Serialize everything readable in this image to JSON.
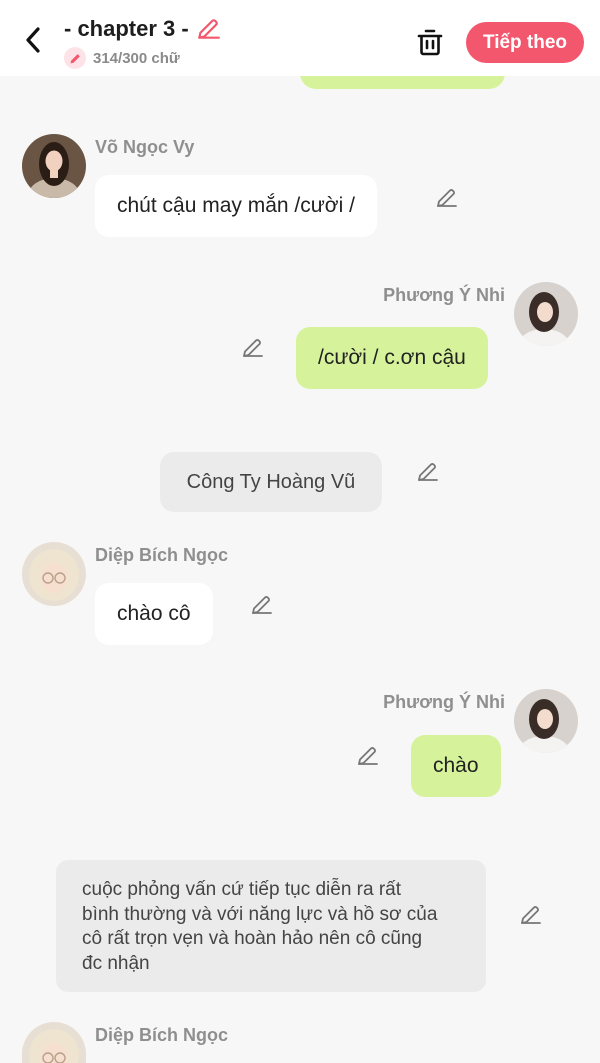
{
  "header": {
    "title": "- chapter 3 -",
    "word_count": "314/300 chữ",
    "next_label": "Tiếp theo",
    "accent_color": "#f2576e"
  },
  "messages": [
    {
      "side": "left",
      "name": "Võ Ngọc Vy",
      "text": "chút cậu may mắn /cười /"
    },
    {
      "side": "right",
      "name": "Phương Ý Nhi",
      "text": "/cười / c.ơn cậu"
    },
    {
      "side": "center",
      "text": "Công Ty Hoàng Vũ"
    },
    {
      "side": "left",
      "name": "Diệp Bích Ngọc",
      "text": "chào cô"
    },
    {
      "side": "right",
      "name": "Phương Ý Nhi",
      "text": "chào"
    },
    {
      "side": "narration",
      "lines": [
        "cuộc phỏng vấn cứ tiếp tục diễn ra rất",
        "bình thường và với năng lực và hồ sơ của",
        "cô rất trọn vẹn và hoàn hảo nên cô cũng",
        "đc nhận"
      ]
    },
    {
      "side": "left",
      "name": "Diệp Bích Ngọc"
    }
  ],
  "icons": {
    "back": "chevron-left-icon",
    "title_edit": "pencil-icon",
    "delete": "trash-icon",
    "edit": "pencil-icon"
  },
  "colors": {
    "my_bubble": "#d6f39b",
    "other_bubble": "#ffffff",
    "scene_bubble": "#ebebeb",
    "background": "#f7f7f7"
  }
}
